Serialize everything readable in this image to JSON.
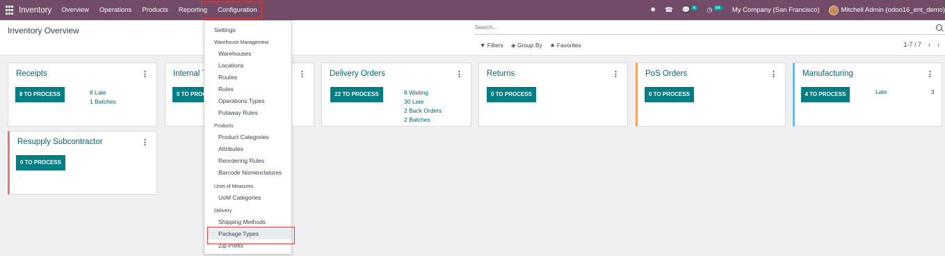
{
  "navbar": {
    "brand": "Inventory",
    "menu": [
      "Overview",
      "Operations",
      "Products",
      "Reporting",
      "Configuration"
    ],
    "chat_count": "6",
    "activity_count": "64",
    "company": "My Company (San Francisco)",
    "user": "Mitchell Admin (odoo16_ent_demo)"
  },
  "control_panel": {
    "breadcrumb": "Inventory Overview",
    "search_placeholder": "Search...",
    "filters_label": "Filters",
    "groupby_label": "Group By",
    "favorites_label": "Favorites",
    "pager": "1-7 / 7"
  },
  "cards": [
    {
      "title": "Receipts",
      "button": "8 TO PROCESS",
      "stats": [
        "8 Late",
        "1 Batches"
      ]
    },
    {
      "title": "Internal Transfers",
      "button": "0 TO PROCESS",
      "stats": []
    },
    {
      "title": "Delivery Orders",
      "button": "22 TO PROCESS",
      "stats": [
        "8 Waiting",
        "30 Late",
        "2 Back Orders",
        "2 Batches"
      ]
    },
    {
      "title": "Returns",
      "button": "0 TO PROCESS",
      "stats": []
    },
    {
      "title": "PoS Orders",
      "button": "0 TO PROCESS",
      "stats": []
    },
    {
      "title": "Manufacturing",
      "button": "4 TO PROCESS",
      "stat_label": "Late",
      "stat_value": "3"
    },
    {
      "title": "Resupply Subcontractor",
      "button": "0 TO PROCESS",
      "stats": []
    }
  ],
  "dropdown": {
    "settings": "Settings",
    "warehouse_header": "Warehouse Management",
    "warehouse_items": [
      "Warehouses",
      "Locations",
      "Routes",
      "Rules",
      "Operations Types",
      "Putaway Rules"
    ],
    "products_header": "Products",
    "products_items": [
      "Product Categories",
      "Attributes",
      "Reordering Rules",
      "Barcode Nomenclatures"
    ],
    "uom_header": "Units of Measures",
    "uom_items": [
      "UoM Categories"
    ],
    "delivery_header": "Delivery",
    "delivery_items": [
      "Shipping Methods",
      "Package Types",
      "Zip Prefix"
    ]
  },
  "colors": {
    "navbar": "#714b67",
    "primary_button": "#017e84",
    "title_teal": "#01666b",
    "highlight_box": "#e53935",
    "pos_accent": "#f4a261",
    "manufacturing_accent": "#6cb8e6",
    "subcontractor_accent": "#e07a7a"
  }
}
